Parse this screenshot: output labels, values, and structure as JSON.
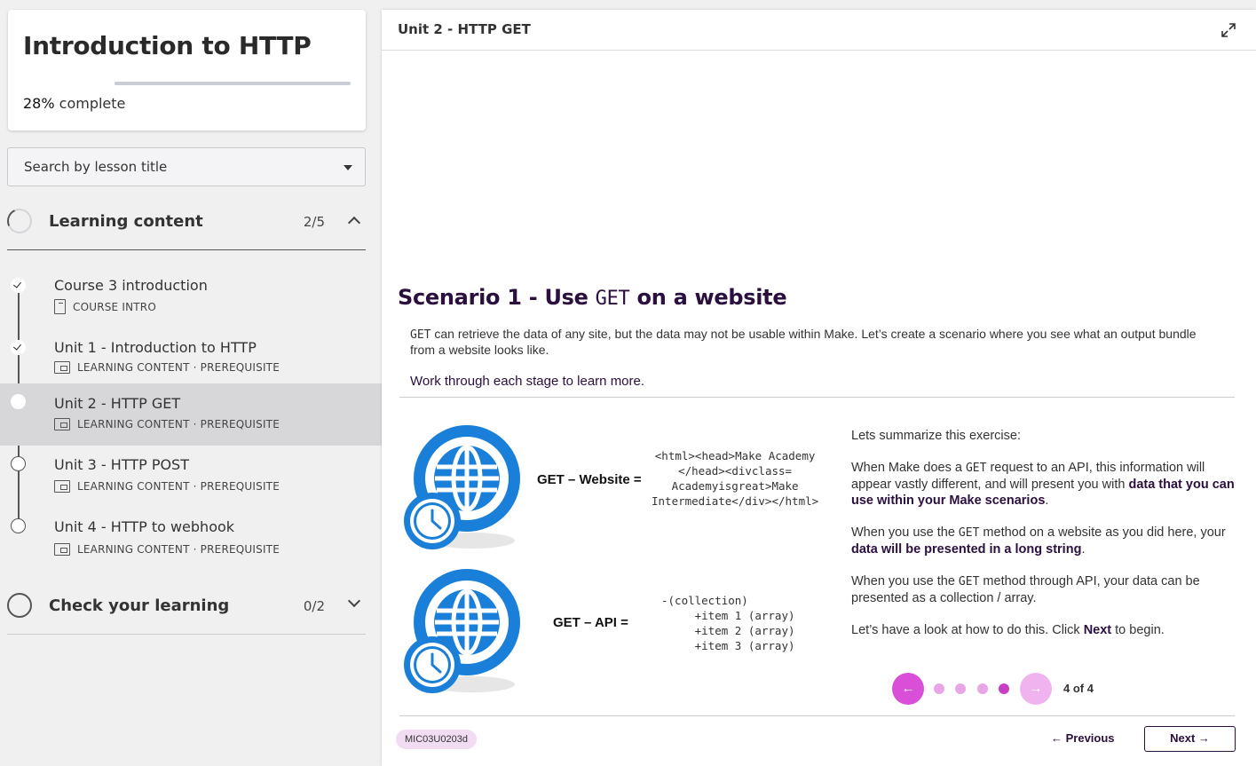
{
  "course": {
    "title": "Introduction to HTTP",
    "progress_percent": 28,
    "progress_pct_label": "28%",
    "progress_suffix": " complete"
  },
  "search": {
    "placeholder": "Search by lesson title"
  },
  "sections": [
    {
      "title": "Learning content",
      "count": "2/5",
      "lessons": [
        {
          "name": "Course 3 introduction",
          "tag": "COURSE INTRO",
          "status": "done"
        },
        {
          "name": "Unit 1 - Introduction to HTTP",
          "tag": "LEARNING CONTENT · PREREQUISITE",
          "status": "done"
        },
        {
          "name": "Unit 2 - HTTP GET",
          "tag": "LEARNING CONTENT · PREREQUISITE",
          "status": "current"
        },
        {
          "name": "Unit 3 - HTTP POST",
          "tag": "LEARNING CONTENT · PREREQUISITE",
          "status": "todo"
        },
        {
          "name": "Unit 4 - HTTP to webhook",
          "tag": "LEARNING CONTENT · PREREQUISITE",
          "status": "todo"
        }
      ]
    },
    {
      "title": "Check your learning",
      "count": "0/2"
    }
  ],
  "panel": {
    "header": "Unit 2 - HTTP GET",
    "scenario_title_pre": "Scenario 1 - Use ",
    "scenario_title_code": "GET",
    "scenario_title_post": " on a website",
    "intro_code": "GET",
    "intro_text": " can retrieve the data of any site, but the data may not be usable within Make. Let’s create a scenario where you see what an output bundle from a website looks like.",
    "work_through": "Work through each stage to learn more.",
    "website_label": "GET – Website =",
    "website_code": "<html><head>Make Academy\n</head><divclass=\nAcademyisgreat>Make\nIntermediate</div></html>",
    "api_label": "GET – API =",
    "api_code": "-(collection)\n     +item 1 (array)\n     +item 2 (array)\n     +item 3 (array)",
    "summary": {
      "p1": "Lets summarize this exercise:",
      "p2_a": "When Make does a ",
      "p2_code": "GET",
      "p2_b": " request to an API, this information will appear vastly different, and will present you with ",
      "p2_bold": "data that you can use within your Make scenarios",
      "p2_c": ".",
      "p3_a": "When you use the ",
      "p3_code": " GET",
      "p3_b": " method on a website as you did here, your ",
      "p3_bold": "data will be presented in a long string",
      "p3_c": ".",
      "p4_a": "When you use the ",
      "p4_code": "GET",
      "p4_b": " method through API, your data can be presented as a collection / array.",
      "p5_a": "Let’s have a look at how to do this. Click ",
      "p5_bold": "Next",
      "p5_b": " to begin."
    },
    "pager": {
      "current": 4,
      "total": 4,
      "label": "4 of 4",
      "prev_icon": "←",
      "next_icon": "→"
    },
    "badge": "MIC03U0203d",
    "prev_label": "← Previous",
    "next_label": "Next →"
  },
  "colors": {
    "accent": "#d94fd7",
    "accent_light": "#f1b3ef",
    "brand_dark": "#2b0f3f",
    "globe_blue": "#1a7fd9"
  },
  "icons": [
    "expand-icon",
    "globe-clock-icon",
    "chevron-up-icon",
    "chevron-down-icon",
    "checkmark-icon",
    "caret-down-icon"
  ]
}
